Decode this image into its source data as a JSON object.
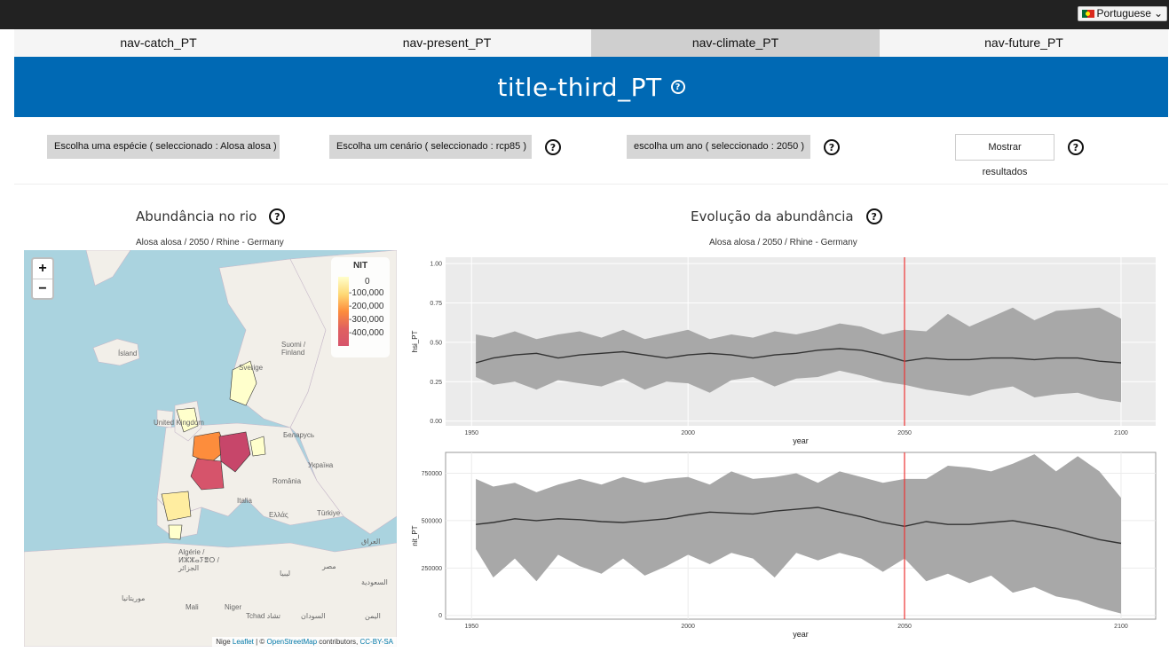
{
  "app": {
    "language_selector": "Portuguese",
    "accent_color": "#0069b4"
  },
  "nav": {
    "tabs": [
      {
        "label": "nav-catch_PT",
        "active": false
      },
      {
        "label": "nav-present_PT",
        "active": false
      },
      {
        "label": "nav-climate_PT",
        "active": true
      },
      {
        "label": "nav-future_PT",
        "active": false
      }
    ]
  },
  "header": {
    "title": "title-third_PT",
    "help_icon": "question-circle-icon"
  },
  "controls": {
    "species_button": "Escolha uma espécie ( seleccionado : Alosa alosa )",
    "scenario_button": "Escolha um cenário ( seleccionado : rcp85 )",
    "year_button": "escolha um ano ( seleccionado : 2050 )",
    "show_results_button": "Mostrar resultados",
    "help_icon": "?"
  },
  "map_panel": {
    "title": "Abundância no rio",
    "subtitle": "Alosa alosa / 2050 / Rhine - Germany",
    "zoom_in": "+",
    "zoom_out": "−",
    "legend": {
      "title": "NIT",
      "labels": [
        "0",
        "100,000",
        "200,000",
        "300,000",
        "400,000"
      ]
    },
    "attribution": {
      "prefix": "Nige",
      "leaflet": "Leaflet",
      "sep": " | © ",
      "osm": "OpenStreetMap",
      "contrib": " contributors, ",
      "license": "CC-BY-SA"
    },
    "place_labels": [
      "Ísland",
      "Suomi / Finland",
      "Sverige",
      "United Kingdom",
      "Беларусь",
      "Україна",
      "România",
      "Italia",
      "Ελλάς",
      "Türkiye",
      "العراق",
      "Algérie / ⵍⵣⵣⴰⵢⴻⵔ / الجزائر",
      "ليبيا",
      "مصر",
      "السعودية",
      "موريتانيا",
      "Mali",
      "Niger",
      "Tchad تشاد",
      "السودان",
      "اليمن"
    ]
  },
  "evolution_panel": {
    "title": "Evolução da abundância",
    "subtitle": "Alosa alosa / 2050 / Rhine - Germany"
  },
  "chart_data": [
    {
      "type": "area",
      "ylabel": "hsi_PT",
      "xlabel": "year",
      "xlim": [
        1944,
        2108
      ],
      "ylim": [
        -0.03,
        1.04
      ],
      "x_ticks": [
        1950,
        2000,
        2050,
        2100
      ],
      "y_ticks": [
        0.0,
        0.25,
        0.5,
        0.75,
        1.0
      ],
      "y_tick_labels": [
        "0.00",
        "0.25",
        "0.50",
        "0.75",
        "1.00"
      ],
      "grid": true,
      "vline": 2050,
      "vline_color": "#ee3333",
      "ribbon_color": "#a8a8a8",
      "line_color": "#333333",
      "x": [
        1951,
        1955,
        1960,
        1965,
        1970,
        1975,
        1980,
        1985,
        1990,
        1995,
        2000,
        2005,
        2010,
        2015,
        2020,
        2025,
        2030,
        2035,
        2040,
        2045,
        2050,
        2055,
        2060,
        2065,
        2070,
        2075,
        2080,
        2085,
        2090,
        2095,
        2100
      ],
      "mean": [
        0.37,
        0.4,
        0.42,
        0.43,
        0.4,
        0.42,
        0.43,
        0.44,
        0.42,
        0.4,
        0.42,
        0.43,
        0.42,
        0.4,
        0.42,
        0.43,
        0.45,
        0.46,
        0.45,
        0.42,
        0.38,
        0.4,
        0.39,
        0.39,
        0.4,
        0.4,
        0.39,
        0.4,
        0.4,
        0.38,
        0.37
      ],
      "upper": [
        0.55,
        0.53,
        0.57,
        0.52,
        0.55,
        0.57,
        0.53,
        0.58,
        0.52,
        0.55,
        0.58,
        0.52,
        0.55,
        0.53,
        0.57,
        0.55,
        0.58,
        0.62,
        0.6,
        0.55,
        0.58,
        0.57,
        0.68,
        0.6,
        0.66,
        0.72,
        0.64,
        0.7,
        0.71,
        0.72,
        0.65
      ],
      "lower": [
        0.28,
        0.23,
        0.25,
        0.2,
        0.26,
        0.24,
        0.22,
        0.27,
        0.2,
        0.25,
        0.24,
        0.18,
        0.26,
        0.28,
        0.22,
        0.27,
        0.28,
        0.32,
        0.29,
        0.25,
        0.23,
        0.2,
        0.18,
        0.16,
        0.2,
        0.22,
        0.15,
        0.17,
        0.18,
        0.14,
        0.12
      ]
    },
    {
      "type": "area",
      "ylabel": "nit_PT",
      "xlabel": "year",
      "xlim": [
        1944,
        2108
      ],
      "ylim": [
        -20000,
        860000
      ],
      "x_ticks": [
        1950,
        2000,
        2050,
        2100
      ],
      "y_ticks": [
        0,
        250000,
        500000,
        750000
      ],
      "y_tick_labels": [
        "0",
        "250000",
        "500000",
        "750000"
      ],
      "grid": true,
      "vline": 2050,
      "vline_color": "#ee3333",
      "ribbon_color": "#a8a8a8",
      "line_color": "#333333",
      "x": [
        1951,
        1955,
        1960,
        1965,
        1970,
        1975,
        1980,
        1985,
        1990,
        1995,
        2000,
        2005,
        2010,
        2015,
        2020,
        2025,
        2030,
        2035,
        2040,
        2045,
        2050,
        2055,
        2060,
        2065,
        2070,
        2075,
        2080,
        2085,
        2090,
        2095,
        2100
      ],
      "mean": [
        480000,
        490000,
        510000,
        500000,
        510000,
        505000,
        495000,
        490000,
        500000,
        510000,
        530000,
        545000,
        540000,
        535000,
        550000,
        560000,
        570000,
        545000,
        520000,
        490000,
        470000,
        495000,
        480000,
        480000,
        490000,
        500000,
        480000,
        460000,
        430000,
        400000,
        380000
      ],
      "upper": [
        720000,
        680000,
        700000,
        650000,
        690000,
        720000,
        690000,
        730000,
        700000,
        720000,
        730000,
        690000,
        760000,
        720000,
        730000,
        750000,
        700000,
        760000,
        730000,
        700000,
        720000,
        720000,
        790000,
        780000,
        760000,
        800000,
        850000,
        760000,
        840000,
        760000,
        620000
      ],
      "lower": [
        350000,
        200000,
        300000,
        180000,
        320000,
        260000,
        220000,
        300000,
        210000,
        260000,
        320000,
        270000,
        330000,
        300000,
        200000,
        330000,
        290000,
        330000,
        300000,
        230000,
        300000,
        180000,
        220000,
        170000,
        210000,
        120000,
        150000,
        100000,
        80000,
        40000,
        10000
      ]
    }
  ]
}
